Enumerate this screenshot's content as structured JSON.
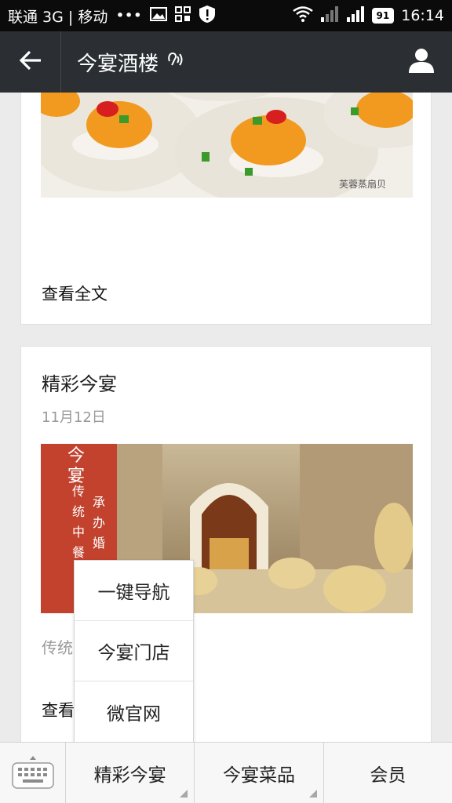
{
  "status_bar": {
    "carrier": "联通 3G | 移动",
    "dots": "•••",
    "battery": "91",
    "time": "16:14"
  },
  "nav": {
    "title": "今宴酒楼",
    "back_icon": "back-arrow-icon",
    "user_icon": "user-icon",
    "voice_icon": "ear-icon"
  },
  "card1": {
    "image_caption": "芙蓉蒸扇贝",
    "read_more": "查看全文"
  },
  "card2": {
    "title": "精彩今宴",
    "date": "11月12日",
    "image_text": [
      "今",
      "宴",
      "传",
      "统",
      "中",
      "餐",
      "承",
      "办",
      "婚"
    ],
    "desc": "传统",
    "read_more": "查看"
  },
  "popup_menu": {
    "items": [
      {
        "label": "一键导航"
      },
      {
        "label": "今宴门店"
      },
      {
        "label": "微官网"
      }
    ]
  },
  "bottom_bar": {
    "keyboard_icon": "keyboard-icon",
    "tabs": [
      {
        "label": "精彩今宴"
      },
      {
        "label": "今宴菜品"
      },
      {
        "label": "会员"
      }
    ]
  },
  "colors": {
    "status_bg": "#0b0b0b",
    "nav_bg": "#2b2f33",
    "page_bg": "#ebebeb",
    "banner_red": "#c3422e"
  }
}
